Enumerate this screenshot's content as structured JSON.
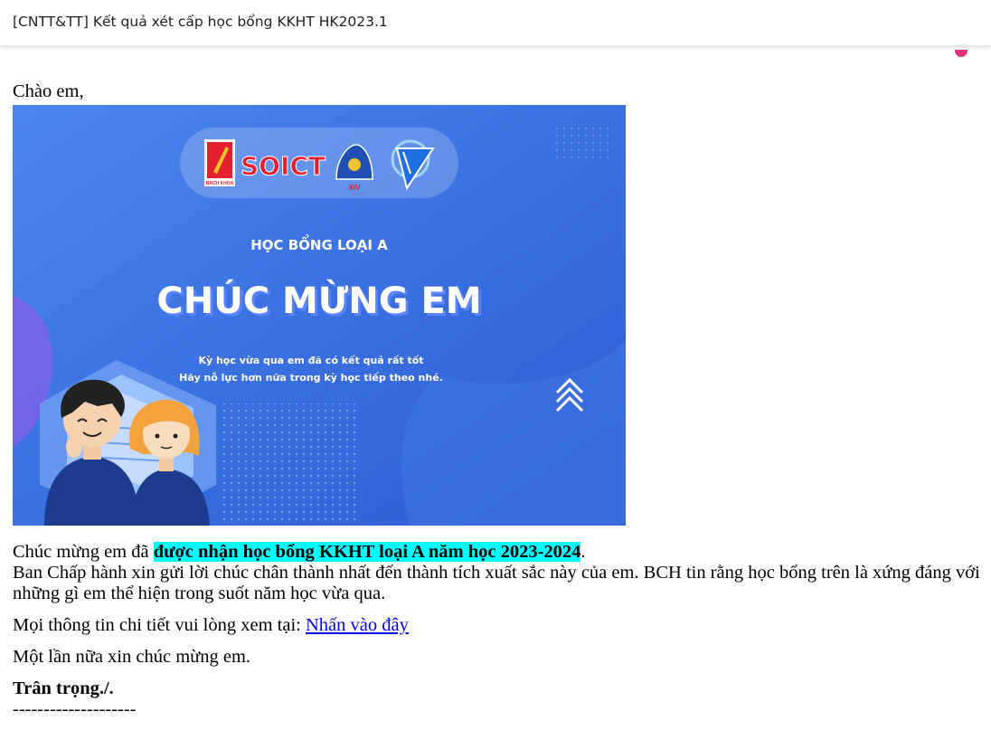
{
  "email": {
    "subject": "[CNTT&TT] Kết quả xét cấp học bổng KKHT HK2023.1",
    "greeting": "Chào em,",
    "banner": {
      "brand": "SOICT",
      "crest_text": "BÁCH KHOA",
      "badge_text": "XIV",
      "subtitle": "HỌC BỔNG LOẠI A",
      "headline": "CHÚC MỪNG EM",
      "line1": "Kỳ học vừa qua em đã có kết quả rất tốt",
      "line2": "Hãy nỗ lực hơn nữa trong kỳ học tiếp theo nhé.",
      "colors": {
        "bg_start": "#4a86ee",
        "bg_end": "#2b5bd3",
        "accent_red": "#e5202e"
      }
    },
    "congrats_prefix": "Chúc mừng em đã ",
    "congrats_highlight": "được nhận học bổng KKHT loại A năm học 2023-2024",
    "congrats_suffix": ".",
    "body_text": "Ban Chấp hành xin gửi lời chúc chân thành nhất đến thành tích xuất sắc này của em. BCH tin rằng học bổng trên là xứng đáng với những gì em thể hiện trong suốt năm học vừa qua.",
    "details_prefix": "Mọi thông tin chi tiết vui lòng xem tại: ",
    "details_link": "Nhấn vào đây",
    "closing": "Một lần nữa xin chúc mừng em.",
    "signoff": "Trân trọng./.",
    "divider": "--------------------",
    "highlight_color": "#00ffff",
    "link_color": "#0000ee"
  }
}
